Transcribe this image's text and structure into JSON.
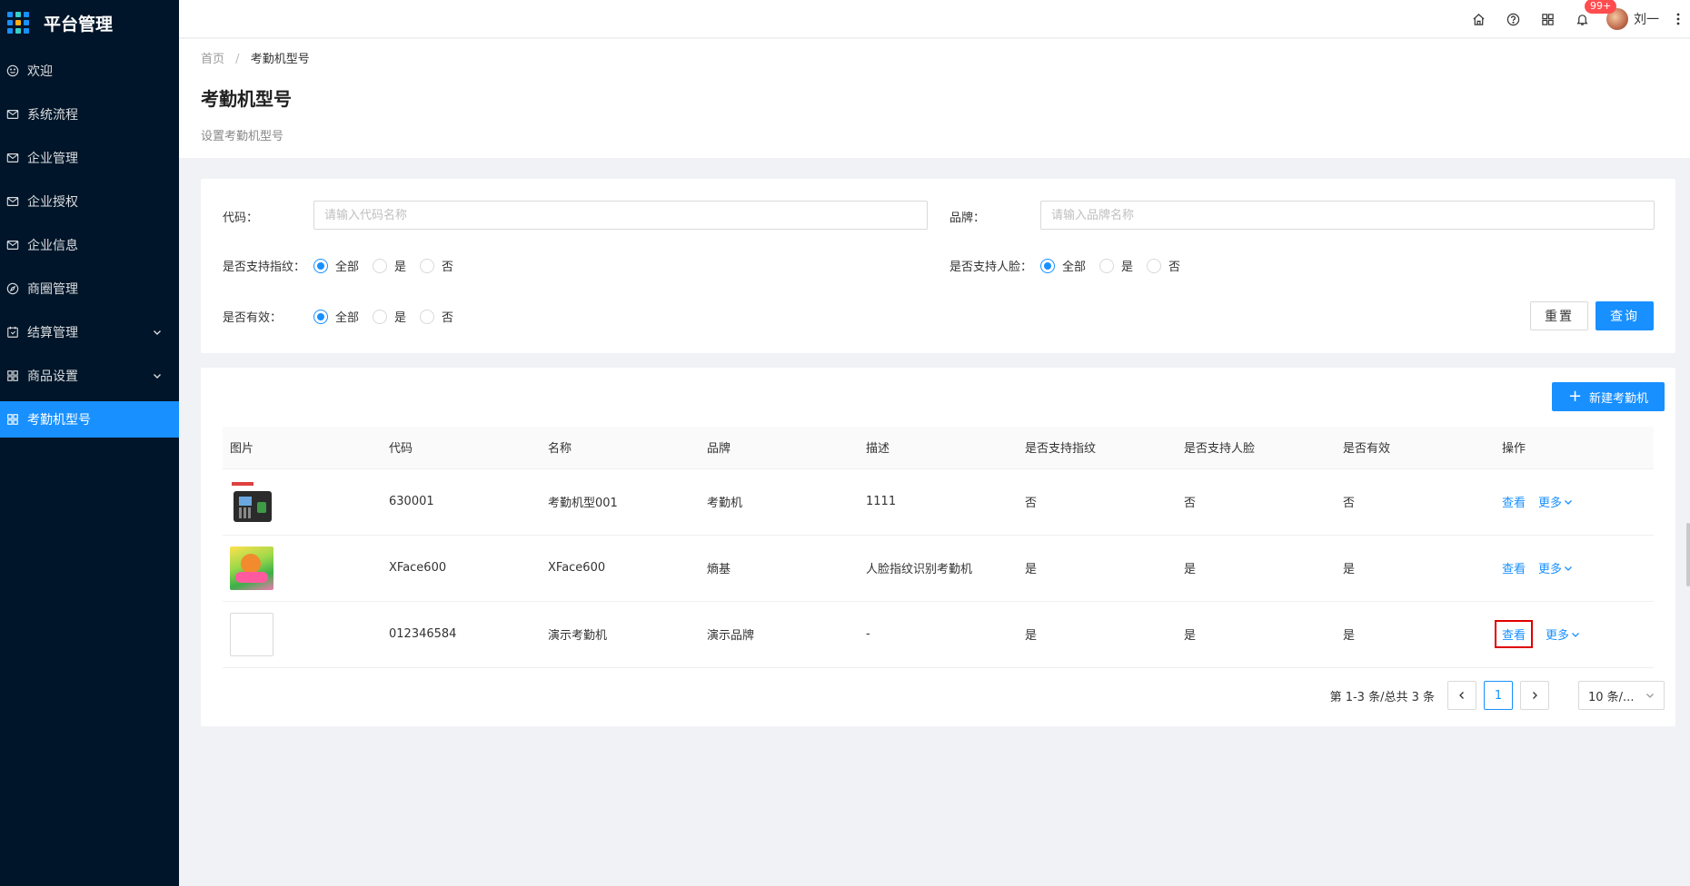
{
  "app": {
    "title": "平台管理"
  },
  "sidebar": {
    "items": [
      {
        "label": "欢迎",
        "icon": "smile-icon"
      },
      {
        "label": "系统流程",
        "icon": "mail-icon"
      },
      {
        "label": "企业管理",
        "icon": "mail-icon"
      },
      {
        "label": "企业授权",
        "icon": "mail-icon"
      },
      {
        "label": "企业信息",
        "icon": "mail-icon"
      },
      {
        "label": "商圈管理",
        "icon": "compass-icon"
      },
      {
        "label": "结算管理",
        "icon": "calendar-icon"
      },
      {
        "label": "商品设置",
        "icon": "appstore-icon"
      },
      {
        "label": "考勤机型号",
        "icon": "appstore-icon"
      }
    ]
  },
  "header": {
    "badge": "99+",
    "user_name": "刘一"
  },
  "breadcrumb": {
    "home": "首页",
    "sep": "/",
    "current": "考勤机型号"
  },
  "page": {
    "title": "考勤机型号",
    "description": "设置考勤机型号"
  },
  "filter": {
    "code_label": "代码：",
    "code_placeholder": "请输入代码名称",
    "brand_label": "品牌：",
    "brand_placeholder": "请输入品牌名称",
    "fingerprint_label": "是否支持指纹：",
    "face_label": "是否支持人脸：",
    "valid_label": "是否有效：",
    "options": [
      "全部",
      "是",
      "否"
    ],
    "selected": "全部",
    "reset_label": "重置",
    "query_label": "查询"
  },
  "table": {
    "new_button": "新建考勤机",
    "columns": [
      "图片",
      "代码",
      "名称",
      "品牌",
      "描述",
      "是否支持指纹",
      "是否支持人脸",
      "是否有效",
      "操作"
    ],
    "rows": [
      {
        "image": "device",
        "code": "630001",
        "name": "考勤机型001",
        "brand": "考勤机",
        "desc": "1111",
        "fingerprint": "否",
        "face": "否",
        "valid": "否"
      },
      {
        "image": "game",
        "code": "XFace600",
        "name": "XFace600",
        "brand": "熵基",
        "desc": "人脸指纹识别考勤机",
        "fingerprint": "是",
        "face": "是",
        "valid": "是"
      },
      {
        "image": "empty",
        "code": "012346584",
        "name": "演示考勤机",
        "brand": "演示品牌",
        "desc": "-",
        "fingerprint": "是",
        "face": "是",
        "valid": "是"
      }
    ],
    "view_label": "查看",
    "more_label": "更多"
  },
  "pagination": {
    "total_text": "第 1-3 条/总共 3 条",
    "current_page": "1",
    "page_size": "10 条/..."
  },
  "colors": {
    "primary": "#1890ff",
    "sidebar_bg": "#001529",
    "highlight_box": "#e00000"
  }
}
